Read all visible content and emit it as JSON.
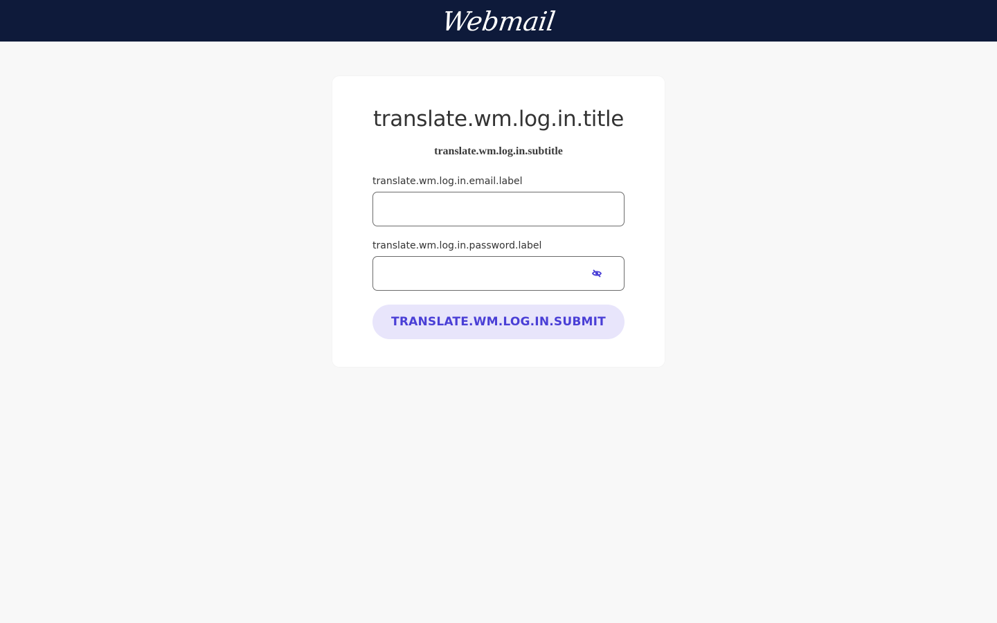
{
  "header": {
    "logo_text": "Webmail",
    "background_color": "#0e1a3a"
  },
  "login": {
    "title": "translate.wm.log.in.title",
    "subtitle": "translate.wm.log.in.subtitle",
    "email": {
      "label": "translate.wm.log.in.email.label",
      "value": "",
      "placeholder": ""
    },
    "password": {
      "label": "translate.wm.log.in.password.label",
      "value": "",
      "placeholder": "",
      "visibility_icon": "eye-slash-icon"
    },
    "submit_label": "translate.wm.log.in.submit",
    "accent_color": "#4a3fd6",
    "button_background": "#e8e5fb"
  }
}
